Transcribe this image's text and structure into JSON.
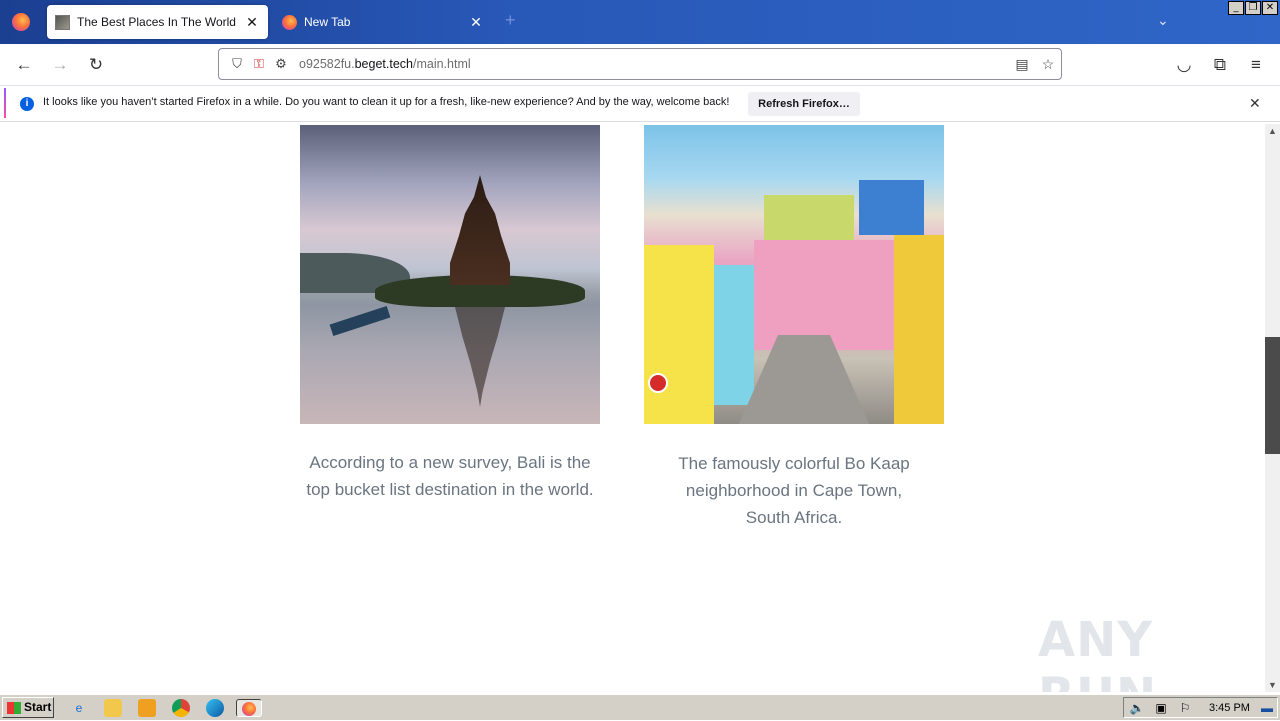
{
  "browser": {
    "tabs": [
      {
        "title": "The Best Places In The World",
        "active": true,
        "close": "✕"
      },
      {
        "title": "New Tab",
        "active": false,
        "close": "✕"
      }
    ],
    "new_tab_icon": "+",
    "tab_list_icon": "⌄",
    "window_controls": {
      "minimize": "_",
      "restore": "❐",
      "close": "✕"
    },
    "nav": {
      "back": "←",
      "forward": "→",
      "reload": "↻"
    },
    "url": {
      "prefix": "o92582fu.",
      "domain": "beget.tech",
      "path": "/main.html"
    },
    "right_icons": {
      "pocket": "◡",
      "extensions": "⧉",
      "menu": "≡",
      "reader": "▤",
      "bookmark": "☆",
      "shield": "⛉",
      "perm": "⚿",
      "tune": "⚙"
    }
  },
  "notification": {
    "message": "It looks like you haven’t started Firefox in a while. Do you want to clean it up for a fresh, like-new experience? And by the way, welcome back!",
    "button": "Refresh Firefox…",
    "info": "i",
    "close": "✕"
  },
  "content": {
    "cards": [
      {
        "caption": "According to a new survey, Bali is the top bucket list destination in the world."
      },
      {
        "caption": "The famously colorful Bo Kaap neighborhood in Cape Town, South Africa."
      }
    ]
  },
  "scrollbar": {
    "up": "▲",
    "down": "▼",
    "position_fraction": 0.42
  },
  "watermark": "ANY RUN",
  "taskbar": {
    "start": "Start",
    "clock": "3:45 PM",
    "quick_icons": [
      "internet-explorer-icon",
      "folder-icon",
      "media-player-icon",
      "chrome-icon",
      "edge-icon",
      "firefox-icon"
    ]
  }
}
